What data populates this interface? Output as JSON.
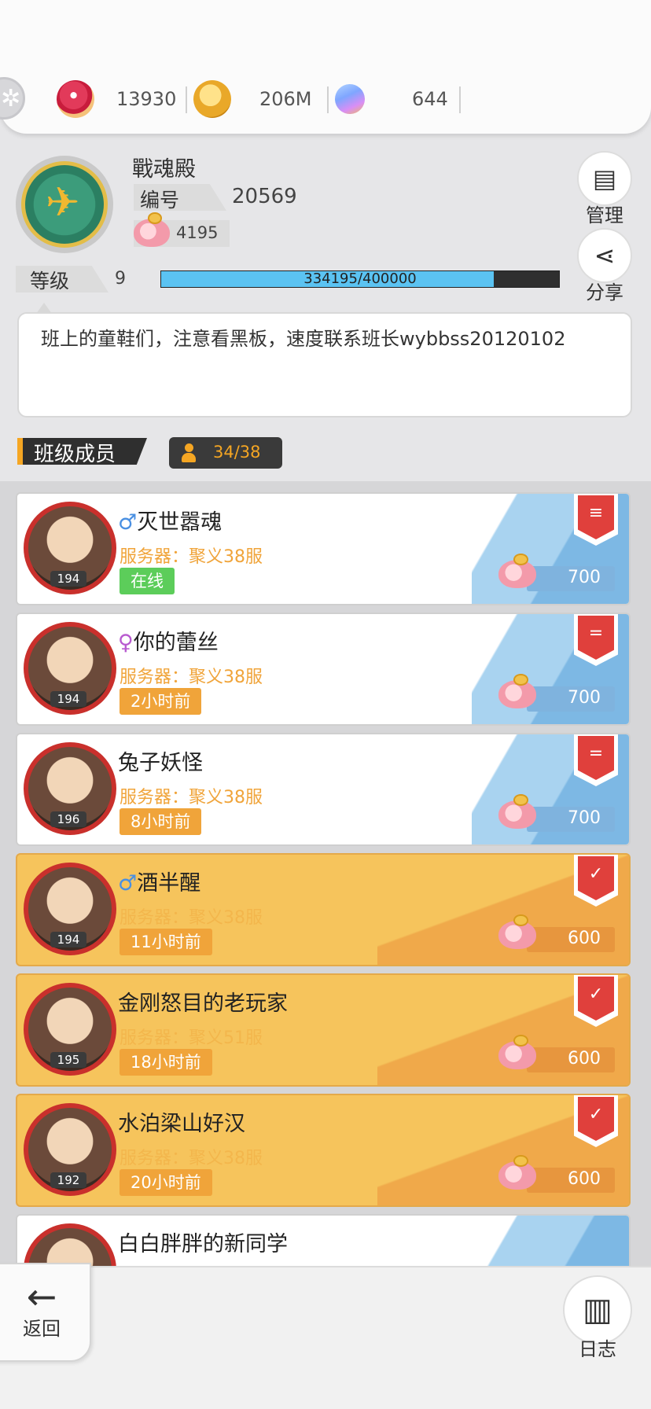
{
  "currencies": [
    {
      "icon": "ruby-icon",
      "value": "13930"
    },
    {
      "icon": "gold-coin-icon",
      "value": "206M"
    },
    {
      "icon": "gem-icon",
      "value": "644"
    }
  ],
  "header": {
    "class_name": "戰魂殿",
    "id_label": "编号",
    "id_value": "20569",
    "savings": "4195",
    "manage_label": "管理",
    "share_label": "分享",
    "level_label": "等级",
    "level_value": "9",
    "xp_text": "334195/400000",
    "xp_progress": 0.835
  },
  "notice": "班上的童鞋们，注意看黑板，速度联系班长wybbss20120102",
  "members_section": {
    "title": "班级成员",
    "count": "34/38"
  },
  "members": [
    {
      "gender": "♂",
      "name": "灭世嚣魂",
      "server": "服务器：聚义38服",
      "level": "194",
      "status": "在线",
      "online": true,
      "contribution": "700",
      "theme": "blue",
      "rank": "≡"
    },
    {
      "gender": "♀",
      "name": "你的蕾丝",
      "server": "服务器：聚义38服",
      "level": "194",
      "status": "2小时前",
      "online": false,
      "contribution": "700",
      "theme": "blue",
      "rank": "="
    },
    {
      "gender": "",
      "name": "兔子妖怪",
      "server": "服务器：聚义38服",
      "level": "196",
      "status": "8小时前",
      "online": false,
      "contribution": "700",
      "theme": "blue",
      "rank": "="
    },
    {
      "gender": "♂",
      "name": "酒半醒",
      "server": "服务器：聚义38服",
      "level": "194",
      "status": "11小时前",
      "online": false,
      "contribution": "600",
      "theme": "gold",
      "rank": "✓"
    },
    {
      "gender": "",
      "name": "金刚怒目的老玩家",
      "server": "服务器：聚义51服",
      "level": "195",
      "status": "18小时前",
      "online": false,
      "contribution": "600",
      "theme": "gold",
      "rank": "✓"
    },
    {
      "gender": "",
      "name": "水泊梁山好汉",
      "server": "服务器：聚义38服",
      "level": "192",
      "status": "20小时前",
      "online": false,
      "contribution": "600",
      "theme": "gold",
      "rank": "✓"
    },
    {
      "gender": "",
      "name": "白白胖胖的新同学",
      "server": "",
      "level": "",
      "status": "",
      "online": false,
      "contribution": "",
      "theme": "blue",
      "rank": ""
    }
  ],
  "footer": {
    "back_label": "返回",
    "log_label": "日志"
  }
}
